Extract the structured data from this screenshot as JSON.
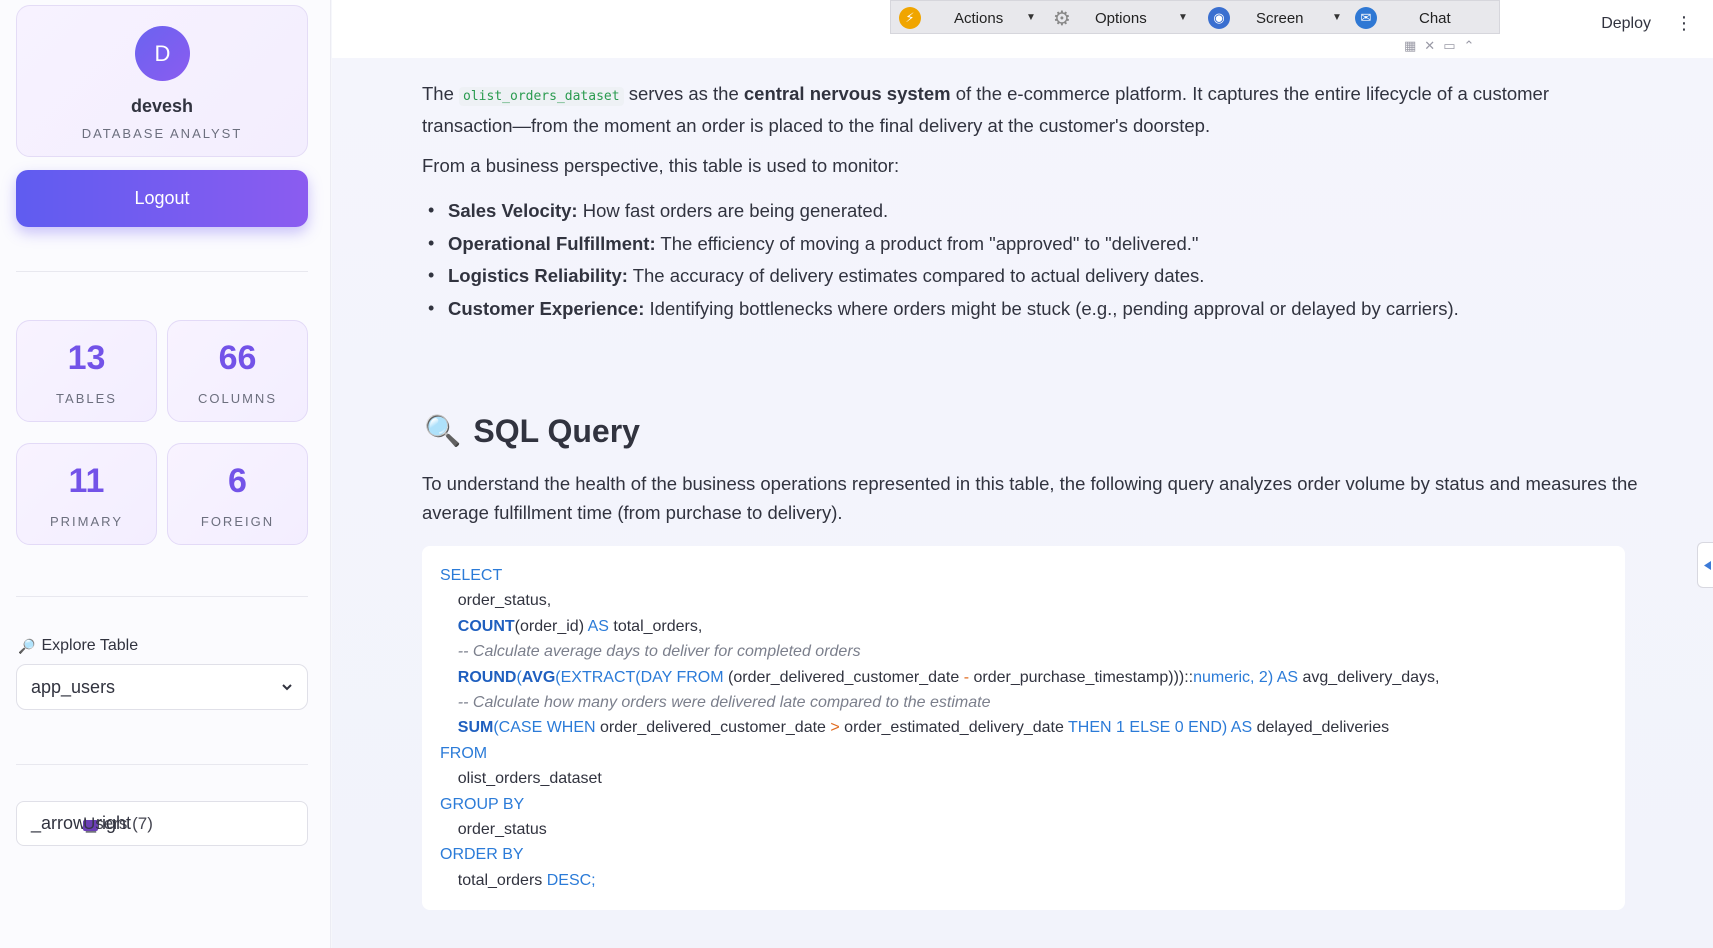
{
  "profile": {
    "avatar_initial": "D",
    "name": "devesh",
    "role": "DATABASE ANALYST"
  },
  "logout_label": "Logout",
  "stats": [
    {
      "value": "13",
      "label": "TABLES"
    },
    {
      "value": "66",
      "label": "COLUMNS"
    },
    {
      "value": "11",
      "label": "PRIMARY"
    },
    {
      "value": "6",
      "label": "FOREIGN"
    }
  ],
  "explore": {
    "label": "Explore Table",
    "selected": "app_users"
  },
  "expander": {
    "arrow_text": "_arrow_right",
    "label": "Users (7)"
  },
  "toolbar": {
    "actions": "Actions",
    "options": "Options",
    "screen": "Screen",
    "chat": "Chat"
  },
  "header": {
    "deploy": "Deploy",
    "menu": "⋮"
  },
  "content": {
    "p1_before": "The ",
    "p1_code": "olist_orders_dataset",
    "p1_mid": " serves as the ",
    "p1_bold": "central nervous system",
    "p1_after": " of the e-commerce platform. It captures the entire lifecycle of a customer transaction—from the moment an order is placed to the final delivery at the customer's doorstep.",
    "p2": "From a business perspective, this table is used to monitor:",
    "bullets": [
      {
        "term": "Sales Velocity:",
        "text": " How fast orders are being generated."
      },
      {
        "term": "Operational Fulfillment:",
        "text": " The efficiency of moving a product from \"approved\" to \"delivered.\""
      },
      {
        "term": "Logistics Reliability:",
        "text": " The accuracy of delivery estimates compared to actual delivery dates."
      },
      {
        "term": "Customer Experience:",
        "text": " Identifying bottlenecks where orders might be stuck (e.g., pending approval or delayed by carriers)."
      }
    ],
    "sql_heading": "SQL Query",
    "p3": "To understand the health of the business operations represented in this table, the following query analyzes order volume by status and measures the average fulfillment time (from purchase to delivery)."
  },
  "sql": {
    "l1": "SELECT",
    "l2": "order_status,",
    "l3_fn": "COUNT",
    "l3_mid": "(order_id) ",
    "l3_kw": "AS",
    "l3_end": " total_orders,",
    "l4": "-- Calculate average days to deliver for completed orders",
    "l5_fn1": "ROUND",
    "l5_p1": "(",
    "l5_fn2": "AVG",
    "l5_p2": "(EXTRACT(",
    "l5_kw1": "DAY FROM",
    "l5_p3": " (order_delivered_customer_date ",
    "l5_op": "-",
    "l5_p4": " order_purchase_timestamp)))::",
    "l5_kw2": "numeric",
    "l5_p5": ", ",
    "l5_num": "2",
    "l5_p6": ") ",
    "l5_kw3": "AS",
    "l5_end": " avg_delivery_days,",
    "l6": "-- Calculate how many orders were delivered late compared to the estimate",
    "l7_fn": "SUM",
    "l7_p1": "(",
    "l7_kw1": "CASE WHEN",
    "l7_p2": " order_delivered_customer_date ",
    "l7_op": ">",
    "l7_p3": " order_estimated_delivery_date ",
    "l7_kw2": "THEN",
    "l7_num1": " 1 ",
    "l7_kw3": "ELSE",
    "l7_num2": " 0 ",
    "l7_kw4": "END",
    "l7_p4": ") ",
    "l7_kw5": "AS",
    "l7_end": " delayed_deliveries",
    "l8": "FROM",
    "l9": "olist_orders_dataset",
    "l10": "GROUP BY",
    "l11": "order_status",
    "l12": "ORDER BY",
    "l13_a": "total_orders ",
    "l13_kw": "DESC;"
  },
  "colors": {
    "accent": "#7353e8",
    "button_gradient_start": "#5f5cf0",
    "button_gradient_end": "#8b5cf0",
    "sql_keyword": "#2b7bd8",
    "inline_code": "#2a9b4f"
  }
}
